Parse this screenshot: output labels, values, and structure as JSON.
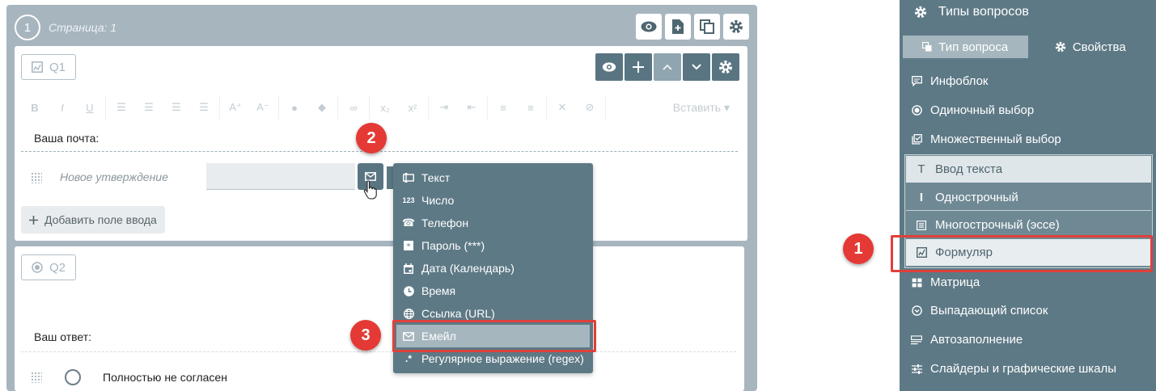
{
  "page": {
    "number": "1",
    "title": "Страница: 1"
  },
  "q1": {
    "tag": "Q1",
    "question_text": "Ваша почта:",
    "statement_placeholder": "Новое утверждение",
    "add_field_label": "Добавить поле ввода",
    "toolbar": {
      "bold": "B",
      "italic": "I",
      "underline": "U",
      "font_plus": "A⁺",
      "font_minus": "A⁻",
      "subscript": "x₂",
      "superscript": "x²",
      "insert_label": "Вставить"
    }
  },
  "q2": {
    "tag": "Q2",
    "question_text": "Ваш ответ:",
    "option_1": "Полностью не согласен"
  },
  "menu": {
    "items": [
      {
        "label": "Текст",
        "icon": "text-field-icon",
        "glyph": ""
      },
      {
        "label": "Число",
        "icon": "number-icon",
        "glyph": "123"
      },
      {
        "label": "Телефон",
        "icon": "phone-icon",
        "glyph": "☎"
      },
      {
        "label": "Пароль (***)",
        "icon": "password-icon",
        "glyph": "✱"
      },
      {
        "label": "Дата (Календарь)",
        "icon": "calendar-icon",
        "glyph": ""
      },
      {
        "label": "Время",
        "icon": "clock-icon",
        "glyph": ""
      },
      {
        "label": "Ссылка (URL)",
        "icon": "globe-icon",
        "glyph": ""
      },
      {
        "label": "Емейл",
        "icon": "mail-icon",
        "glyph": ""
      },
      {
        "label": "Регулярное выражение (regex)",
        "icon": "regex-icon",
        "glyph": ".*"
      }
    ]
  },
  "badges": {
    "one": "1",
    "two": "2",
    "three": "3"
  },
  "panel": {
    "title": "Типы вопросов",
    "tab_type": "Тип вопроса",
    "tab_props": "Свойства",
    "items": {
      "info": "Инфоблок",
      "single": "Одиночный выбор",
      "multi": "Множественный выбор",
      "text_input": "Ввод текста",
      "single_line": "Однострочный",
      "multi_line": "Многострочный (эссе)",
      "form": "Формуляр",
      "matrix": "Матрица",
      "dropdown": "Выпадающий список",
      "autofill": "Автозаполнение",
      "sliders": "Слайдеры и графические шкалы"
    }
  },
  "colors": {
    "accent": "#5d7985",
    "badge": "#e53935",
    "page_bg": "#a7b5bf"
  }
}
